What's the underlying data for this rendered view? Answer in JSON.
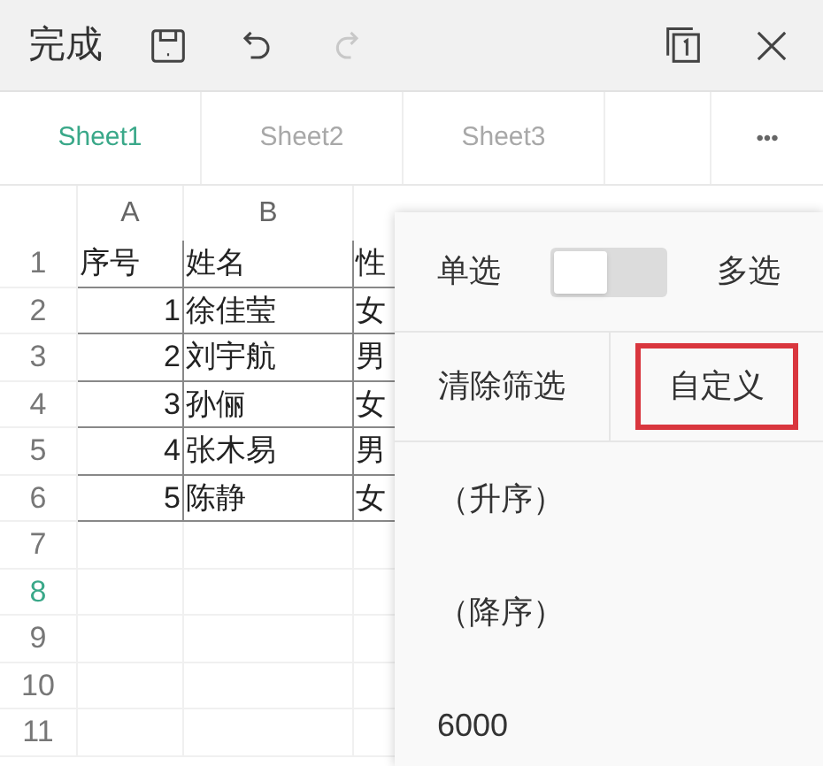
{
  "toolbar": {
    "done": "完成"
  },
  "tabs": [
    {
      "label": "Sheet1",
      "selected": true
    },
    {
      "label": "Sheet2",
      "selected": false
    },
    {
      "label": "Sheet3",
      "selected": false
    }
  ],
  "more": "•••",
  "grid": {
    "columns": [
      "A",
      "B"
    ],
    "rows": [
      {
        "number": "1",
        "selected": false,
        "cells": [
          {
            "text": "序号",
            "kind": "text"
          },
          {
            "text": "姓名",
            "kind": "text"
          },
          {
            "text": "性",
            "kind": "text"
          }
        ]
      },
      {
        "number": "2",
        "selected": false,
        "cells": [
          {
            "text": "1",
            "kind": "number"
          },
          {
            "text": "徐佳莹",
            "kind": "text"
          },
          {
            "text": "女",
            "kind": "text"
          }
        ]
      },
      {
        "number": "3",
        "selected": false,
        "cells": [
          {
            "text": "2",
            "kind": "number"
          },
          {
            "text": "刘宇航",
            "kind": "text"
          },
          {
            "text": "男",
            "kind": "text"
          }
        ]
      },
      {
        "number": "4",
        "selected": false,
        "cells": [
          {
            "text": "3",
            "kind": "number"
          },
          {
            "text": "孙俪",
            "kind": "text"
          },
          {
            "text": "女",
            "kind": "text"
          }
        ]
      },
      {
        "number": "5",
        "selected": false,
        "cells": [
          {
            "text": "4",
            "kind": "number"
          },
          {
            "text": "张木易",
            "kind": "text"
          },
          {
            "text": "男",
            "kind": "text"
          }
        ]
      },
      {
        "number": "6",
        "selected": false,
        "cells": [
          {
            "text": "5",
            "kind": "number"
          },
          {
            "text": "陈静",
            "kind": "text"
          },
          {
            "text": "女",
            "kind": "text"
          }
        ]
      },
      {
        "number": "7",
        "selected": false,
        "cells": []
      },
      {
        "number": "8",
        "selected": true,
        "cells": []
      },
      {
        "number": "9",
        "selected": false,
        "cells": []
      },
      {
        "number": "10",
        "selected": false,
        "cells": []
      },
      {
        "number": "11",
        "selected": false,
        "cells": []
      }
    ]
  },
  "filter_panel": {
    "mode": {
      "left": "单选",
      "right": "多选",
      "on": false
    },
    "actions": [
      {
        "label": "清除筛选",
        "highlighted": false
      },
      {
        "label": "自定义",
        "highlighted": true
      }
    ],
    "items": [
      "（升序）",
      "（降序）",
      "6000"
    ]
  }
}
